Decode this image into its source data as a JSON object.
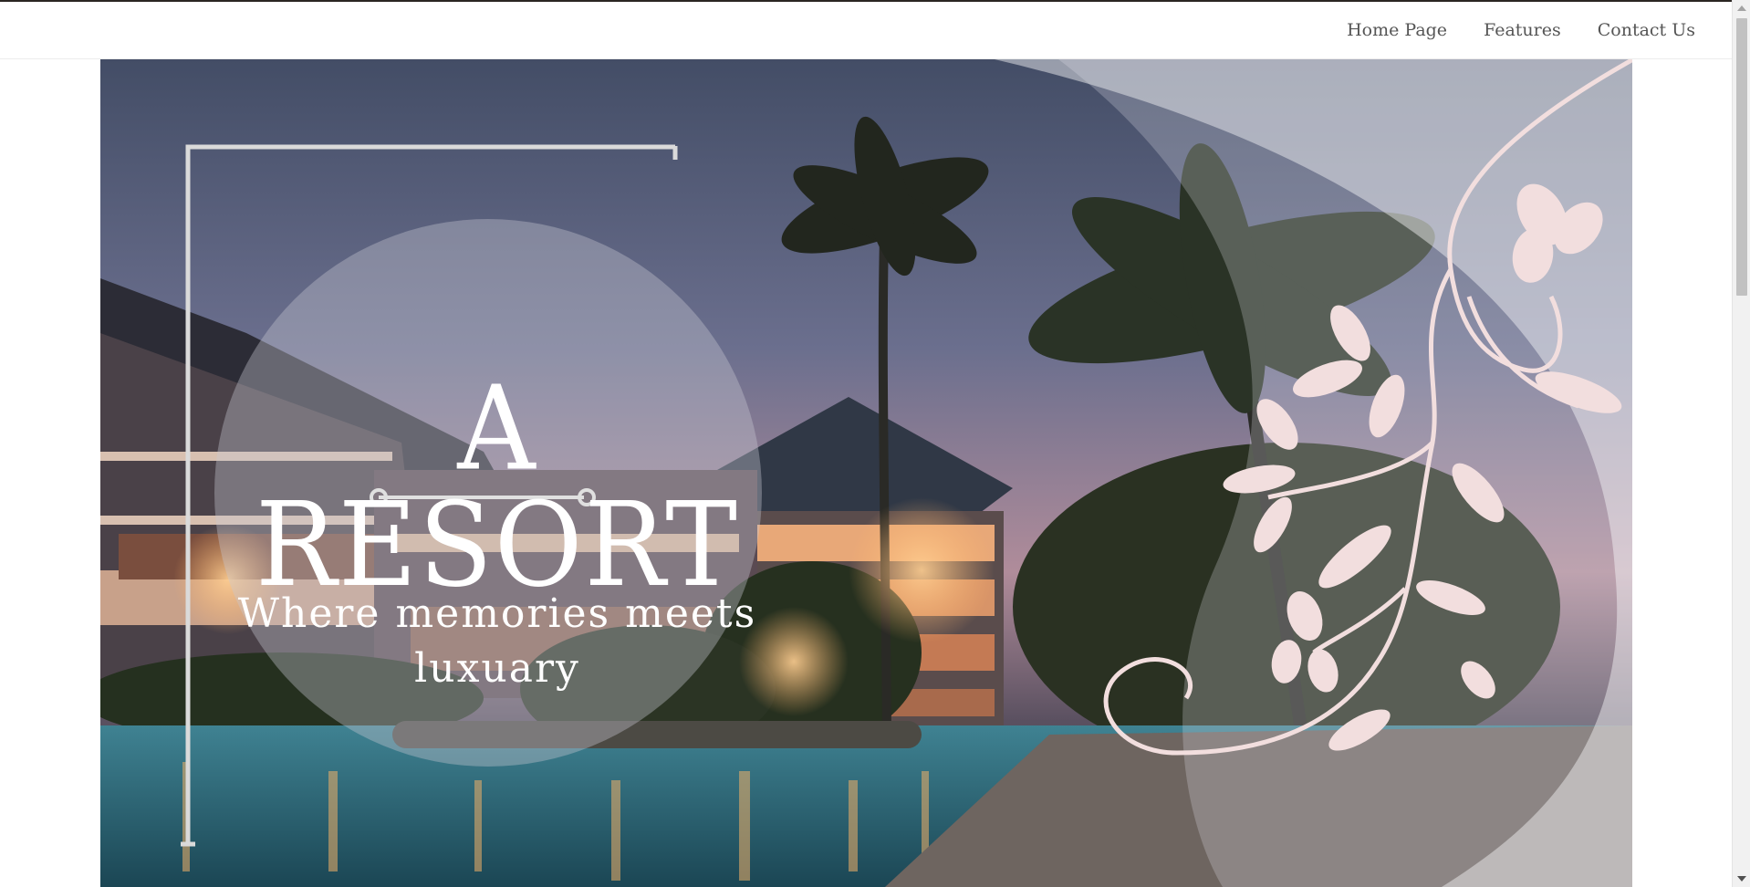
{
  "nav": {
    "links": [
      "Home Page",
      "Features",
      "Contact Us"
    ]
  },
  "hero": {
    "title": "A RESORT",
    "subtitle": "Where memories meets luxuary",
    "background_image": "resort-pool-dusk-photo",
    "decoration": "floral-vine-ornament"
  },
  "colors": {
    "sky": "#5a6582",
    "dusk_pink": "#b88e9c",
    "pool": "#2f6d80",
    "floral": "#f2dede",
    "text": "#ffffff",
    "nav_text": "#555555"
  }
}
